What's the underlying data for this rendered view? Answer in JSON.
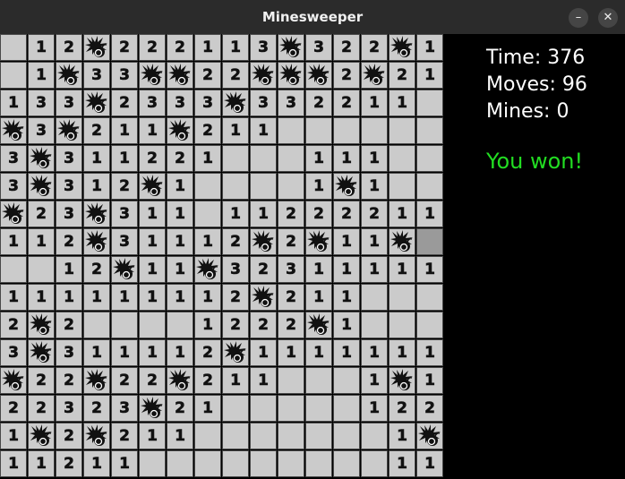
{
  "window": {
    "title": "Minesweeper",
    "minimize_label": "–",
    "close_label": "✕"
  },
  "stats": {
    "time": "Time: 376",
    "moves": "Moves: 96",
    "mines": "Mines: 0",
    "status": "You won!"
  },
  "colors": {
    "cell_open": "#cbcbcb",
    "cell_closed": "#9a9a9a",
    "status_won": "#22dd22"
  },
  "legend": {
    "mine_symbol": "M",
    "closed_symbol": "C",
    "empty_symbol": "."
  },
  "board": {
    "rows": [
      [
        ".",
        "1",
        "2",
        "M",
        "2",
        "2",
        "2",
        "1",
        "1",
        "3",
        "M",
        "3",
        "2",
        "2",
        "M",
        "1"
      ],
      [
        ".",
        "1",
        "M",
        "3",
        "3",
        "M",
        "M",
        "2",
        "2",
        "M",
        "M",
        "M",
        "2",
        "M",
        "2",
        "1"
      ],
      [
        "1",
        "3",
        "3",
        "M",
        "2",
        "3",
        "3",
        "3",
        "M",
        "3",
        "3",
        "2",
        "2",
        "1",
        "1",
        "."
      ],
      [
        "M",
        "3",
        "M",
        "2",
        "1",
        "1",
        "M",
        "2",
        "1",
        "1",
        ".",
        ".",
        ".",
        ".",
        ".",
        "."
      ],
      [
        "3",
        "M",
        "3",
        "1",
        "1",
        "2",
        "2",
        "1",
        ".",
        ".",
        ".",
        "1",
        "1",
        "1",
        ".",
        "."
      ],
      [
        "3",
        "M",
        "3",
        "1",
        "2",
        "M",
        "1",
        ".",
        ".",
        ".",
        ".",
        "1",
        "M",
        "1",
        ".",
        "."
      ],
      [
        "M",
        "2",
        "3",
        "M",
        "3",
        "1",
        "1",
        ".",
        "1",
        "1",
        "2",
        "2",
        "2",
        "2",
        "1",
        "1"
      ],
      [
        "1",
        "1",
        "2",
        "M",
        "3",
        "1",
        "1",
        "1",
        "2",
        "M",
        "2",
        "M",
        "1",
        "1",
        "M",
        "C"
      ],
      [
        ".",
        ".",
        "1",
        "2",
        "M",
        "1",
        "1",
        "M",
        "3",
        "2",
        "3",
        "1",
        "1",
        "1",
        "1",
        "1"
      ],
      [
        "1",
        "1",
        "1",
        "1",
        "1",
        "1",
        "1",
        "1",
        "2",
        "M",
        "2",
        "1",
        "1",
        ".",
        ".",
        "."
      ],
      [
        "2",
        "M",
        "2",
        ".",
        ".",
        ".",
        ".",
        "1",
        "2",
        "2",
        "2",
        "M",
        "1",
        ".",
        ".",
        "."
      ],
      [
        "3",
        "M",
        "3",
        "1",
        "1",
        "1",
        "1",
        "2",
        "M",
        "1",
        "1",
        "1",
        "1",
        "1",
        "1",
        "1"
      ],
      [
        "M",
        "2",
        "2",
        "M",
        "2",
        "2",
        "M",
        "2",
        "1",
        "1",
        ".",
        ".",
        ".",
        "1",
        "M",
        "1"
      ],
      [
        "2",
        "2",
        "3",
        "2",
        "3",
        "M",
        "2",
        "1",
        ".",
        ".",
        ".",
        ".",
        ".",
        "1",
        "2",
        "2"
      ],
      [
        "1",
        "M",
        "2",
        "M",
        "2",
        "1",
        "1",
        ".",
        ".",
        ".",
        ".",
        ".",
        ".",
        ".",
        "1",
        "M"
      ],
      [
        "1",
        "1",
        "2",
        "1",
        "1",
        ".",
        ".",
        ".",
        ".",
        ".",
        ".",
        ".",
        ".",
        ".",
        "1",
        "1"
      ]
    ]
  }
}
